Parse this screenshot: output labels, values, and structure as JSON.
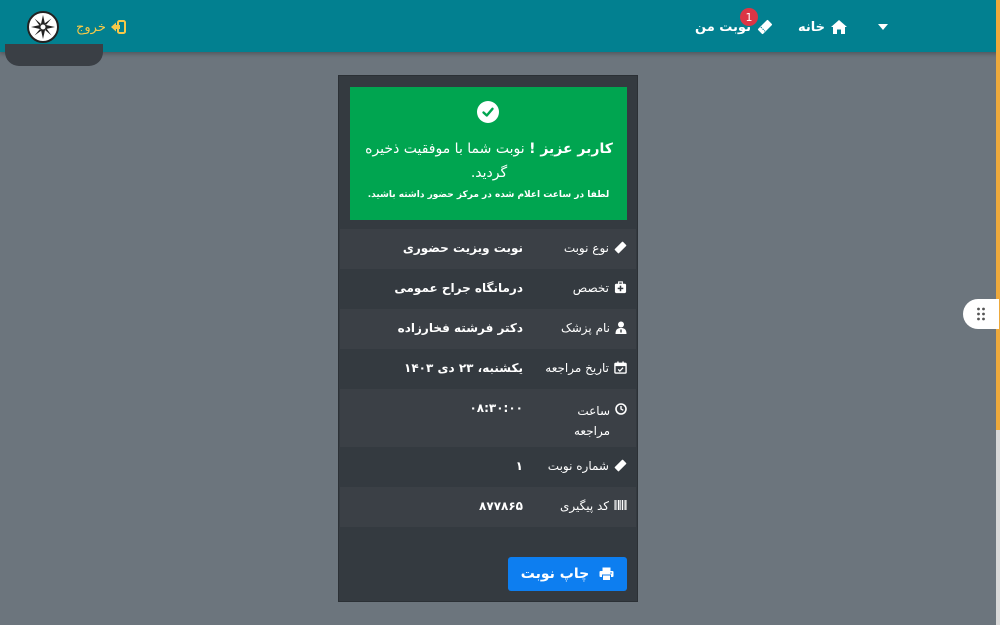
{
  "navbar": {
    "exit_label": "خروج",
    "home_label": "خانه",
    "my_appointment_label": "نوبت من",
    "badge_count": "1"
  },
  "alert": {
    "greeting": "کاربر عزیز !",
    "message": "نوبت شما با موفقیت ذخیره گردید.",
    "note": "لطفا در ساعت اعلام شده در مرکز حضور داشته باشید."
  },
  "details": [
    {
      "label": "نوع نوبت",
      "value": "نوبت ویزیت حضوری",
      "icon": "ticket-icon"
    },
    {
      "label": "تخصص",
      "value": "درمانگاه جراح عمومی",
      "icon": "medical-kit-icon"
    },
    {
      "label": "نام پزشک",
      "value": "دکتر فرشته فخارزاده",
      "icon": "doctor-icon"
    },
    {
      "label": "تاریخ مراجعه",
      "value": "یکشنبه، ۲۳ دی ۱۴۰۳",
      "icon": "calendar-check-icon"
    },
    {
      "label": "ساعت مراجعه",
      "value": "۰۸:۳۰:۰۰",
      "icon": "clock-icon"
    },
    {
      "label": "شماره نوبت",
      "value": "۱",
      "icon": "ticket-icon"
    },
    {
      "label": "کد پیگیری",
      "value": "۸۷۷۸۶۵",
      "icon": "barcode-icon"
    }
  ],
  "print_button_label": "چاپ نوبت",
  "colors": {
    "navbar": "#028090",
    "success": "#00a550",
    "card": "#343a40",
    "primary": "#0d7ef0",
    "exit": "#f7c948"
  }
}
